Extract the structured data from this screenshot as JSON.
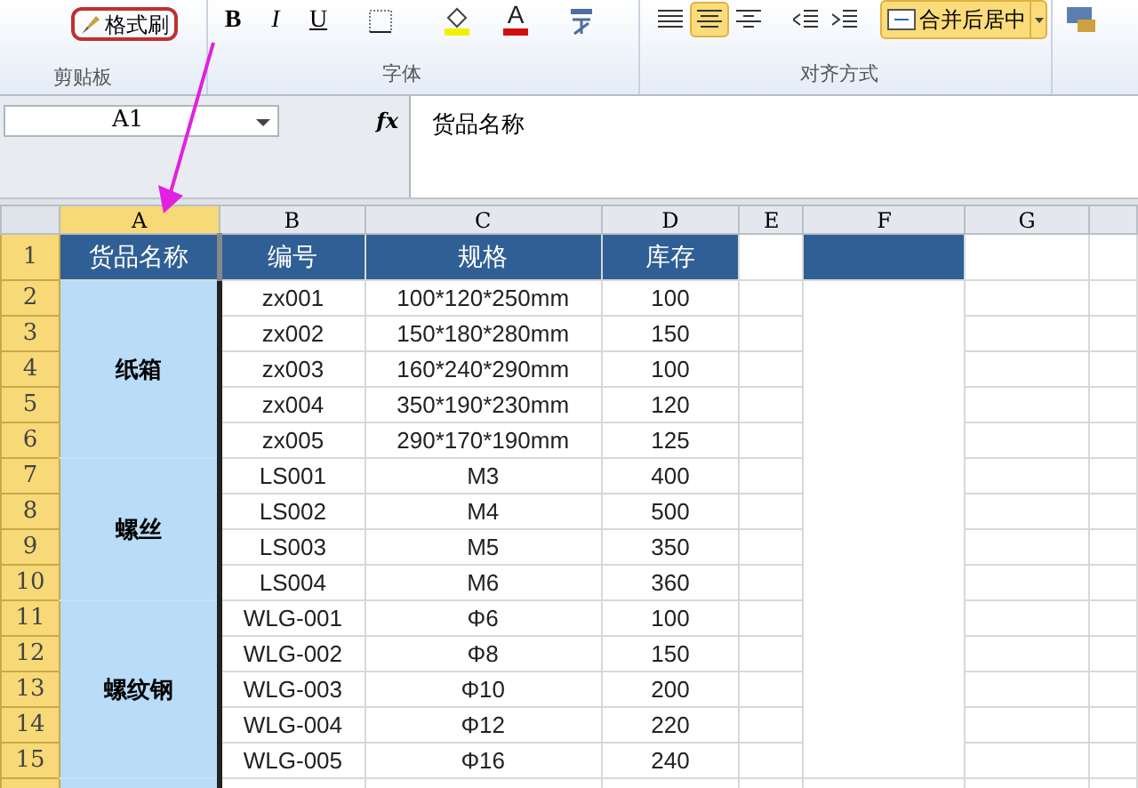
{
  "ribbon": {
    "clipboard": {
      "format_painter": "格式刷",
      "label": "剪贴板"
    },
    "font": {
      "buttons": [
        {
          "label": "B",
          "kind": "bold"
        },
        {
          "label": "I",
          "kind": "italic"
        },
        {
          "label": "U",
          "kind": "underline"
        }
      ],
      "font_color": "A",
      "label": "字体"
    },
    "alignment": {
      "align_buttons": [
        {
          "kind": "left",
          "selected": false
        },
        {
          "kind": "center",
          "selected": true
        },
        {
          "kind": "right",
          "selected": false
        }
      ],
      "merge_button": {
        "label": "合并后居中",
        "selected": true
      },
      "label": "对齐方式"
    }
  },
  "formula_bar": {
    "name_box": "A1",
    "fx": "fx",
    "formula": "货品名称"
  },
  "sheet": {
    "columns": [
      {
        "letter": "A",
        "selected": true
      },
      {
        "letter": "B",
        "selected": false
      },
      {
        "letter": "C",
        "selected": false
      },
      {
        "letter": "D",
        "selected": false
      },
      {
        "letter": "E",
        "selected": false
      },
      {
        "letter": "F",
        "selected": false
      },
      {
        "letter": "G",
        "selected": false
      }
    ],
    "rows": [
      {
        "number": "1",
        "selected": true
      },
      {
        "number": "2",
        "selected": true
      },
      {
        "number": "3",
        "selected": true
      },
      {
        "number": "4",
        "selected": true
      },
      {
        "number": "5",
        "selected": true
      },
      {
        "number": "6",
        "selected": true
      },
      {
        "number": "7",
        "selected": true
      },
      {
        "number": "8",
        "selected": true
      },
      {
        "number": "9",
        "selected": true
      },
      {
        "number": "10",
        "selected": true
      },
      {
        "number": "11",
        "selected": true
      },
      {
        "number": "12",
        "selected": true
      },
      {
        "number": "13",
        "selected": true
      },
      {
        "number": "14",
        "selected": true
      },
      {
        "number": "15",
        "selected": true
      }
    ],
    "header": [
      "货品名称",
      "编号",
      "规格",
      "库存"
    ],
    "groups": [
      {
        "name": "纸箱",
        "items": [
          {
            "code": "zx001",
            "spec": "100*120*250mm",
            "stock": "100"
          },
          {
            "code": "zx002",
            "spec": "150*180*280mm",
            "stock": "150"
          },
          {
            "code": "zx003",
            "spec": "160*240*290mm",
            "stock": "100"
          },
          {
            "code": "zx004",
            "spec": "350*190*230mm",
            "stock": "120"
          },
          {
            "code": "zx005",
            "spec": "290*170*190mm",
            "stock": "125"
          }
        ]
      },
      {
        "name": "螺丝",
        "items": [
          {
            "code": "LS001",
            "spec": "M3",
            "stock": "400"
          },
          {
            "code": "LS002",
            "spec": "M4",
            "stock": "500"
          },
          {
            "code": "LS003",
            "spec": "M5",
            "stock": "350"
          },
          {
            "code": "LS004",
            "spec": "M6",
            "stock": "360"
          }
        ]
      },
      {
        "name": "螺纹钢",
        "items": [
          {
            "code": "WLG-001",
            "spec": "Φ6",
            "stock": "100"
          },
          {
            "code": "WLG-002",
            "spec": "Φ8",
            "stock": "150"
          },
          {
            "code": "WLG-003",
            "spec": "Φ10",
            "stock": "200"
          },
          {
            "code": "WLG-004",
            "spec": "Φ12",
            "stock": "220"
          },
          {
            "code": "WLG-005",
            "spec": "Φ16",
            "stock": "240"
          }
        ]
      }
    ]
  }
}
